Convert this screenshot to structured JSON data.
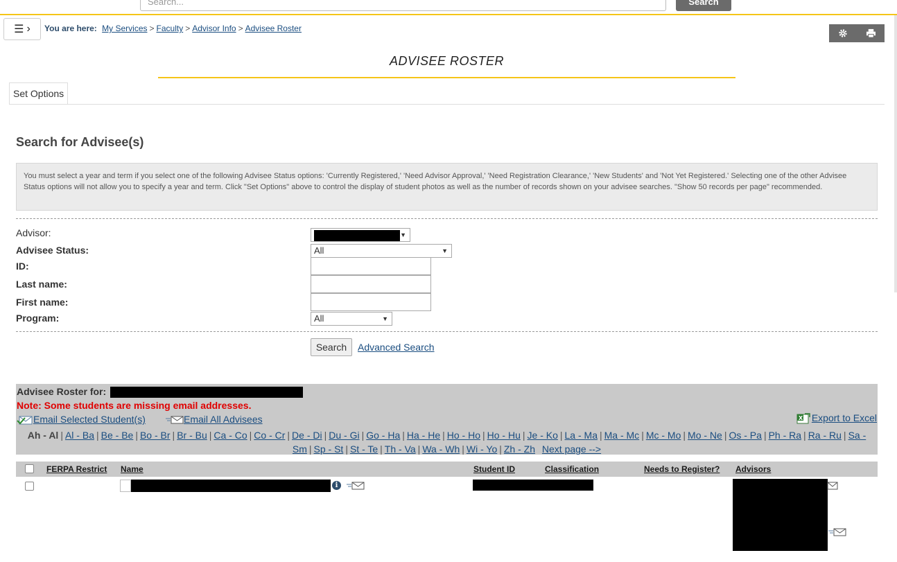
{
  "top": {
    "search_placeholder": "Search...",
    "search_label": "Search"
  },
  "breadcrumb": {
    "label": "You are here:",
    "items": [
      "My Services",
      "Faculty",
      "Advisor Info",
      "Advisee Roster"
    ]
  },
  "page_title": "ADVISEE ROSTER",
  "tabs": [
    {
      "label": "Set Options"
    }
  ],
  "search_section": {
    "heading": "Search for Advisee(s)",
    "info": "You must select a year and term if you select one of the following Advisee Status options: 'Currently Registered,' 'Need Advisor Approval,' 'Need Registration Clearance,' 'New Students' and 'Not Yet Registered.' Selecting one of the other Advisee Status options will not allow you to specify a year and term. Click \"Set Options\" above to control the display of student photos as well as the number of records shown on your advisee searches. \"Show 50 records per page\" recommended."
  },
  "form": {
    "advisor_label": "Advisor:",
    "status_label": "Advisee Status:",
    "status_value": "All",
    "id_label": "ID:",
    "last_name_label": "Last name:",
    "first_name_label": "First name:",
    "program_label": "Program:",
    "program_value": "All",
    "search_button": "Search",
    "advanced_search": "Advanced Search"
  },
  "roster": {
    "for_label": "Advisee Roster for:",
    "note": "Note: Some students are missing email addresses.",
    "email_selected": "Email Selected Student(s)",
    "email_all": "Email All Advisees",
    "export": "Export to Excel",
    "alpha_current": "Ah - Al",
    "alpha_links": [
      "Al - Ba",
      "Be - Be",
      "Bo - Br",
      "Br - Bu",
      "Ca - Co",
      "Co - Cr",
      "De - Di",
      "Du - Gi",
      "Go - Ha",
      "Ha - He",
      "Ho - Ho",
      "Ho - Hu",
      "Je - Ko",
      "La - Ma",
      "Ma - Mc",
      "Mc - Mo",
      "Mo - Ne",
      "Os - Pa",
      "Ph - Ra",
      "Ra - Ru",
      "Sa - Sm",
      "Sp - St",
      "St - Te",
      "Th - Va",
      "Wa - Wh",
      "Wi - Yo",
      "Zh - Zh"
    ],
    "next_page": "Next page -->"
  },
  "table": {
    "headers": {
      "ferpa": "FERPA Restrict",
      "name": "Name",
      "student_id": "Student ID",
      "classification": "Classification",
      "needs_register": "Needs to Register?",
      "advisors": "Advisors"
    }
  },
  "colors": {
    "accent": "#f5c518",
    "panel": "#c9c9c9",
    "link": "#1a4d80",
    "note": "#e00000",
    "tool": "#6b6b6b"
  }
}
